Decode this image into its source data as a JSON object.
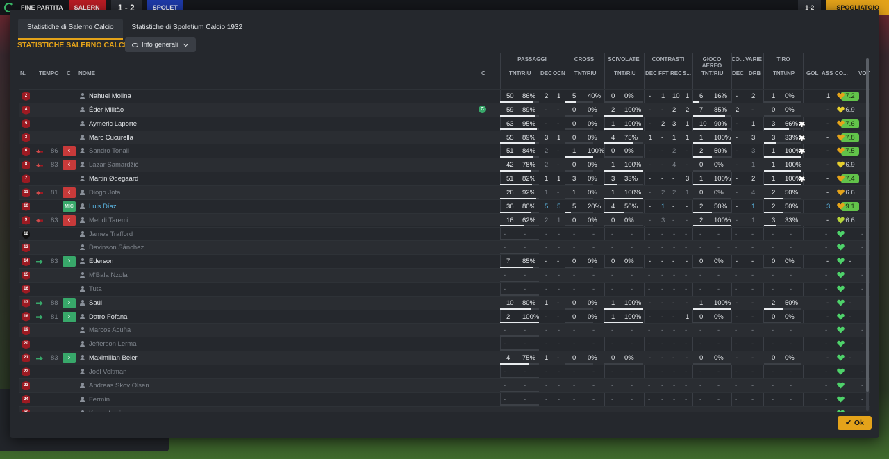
{
  "top_bar": {
    "status": "FINE PARTITA",
    "team1": "SALERN",
    "score": "1 - 2",
    "team2": "SPOLET",
    "score_right": "1-2",
    "continue": "SPOGLIATOIO"
  },
  "tabs": [
    "Statistiche di Salerno Calcio",
    "Statistiche di Spoletium Calcio 1932"
  ],
  "section_title": "STATISTICHE SALERNO CALCIO",
  "view_select": "Info generali",
  "groups": {
    "passaggi": "PASSAGGI",
    "cross": "CROSS",
    "scivolate": "SCIVOLATE",
    "contrasti": "CONTRASTI",
    "gioco_aereo": "GIOCO AEREO",
    "co": "CO...",
    "varie": "VARIE",
    "tiro": "TIRO"
  },
  "headers": {
    "n": "N.",
    "tempo": "TEMPO",
    "c": "C",
    "nome": "NOME",
    "c2": "C",
    "tnt_riu": "TNT/RIU",
    "dec": "DEC",
    "ocn": "OCN",
    "cross_tnt": "TNT/RIU",
    "sciv_tnt": "TNT/RIU",
    "con_dec": "DEC",
    "fft": "FFT",
    "rec": "REC",
    "s": "S...",
    "aereo_tnt": "TNT/RIU",
    "co_dec": "DEC",
    "drb": "DRB",
    "tiro_tnt": "TNT\\INP",
    "gol": "GOL",
    "ass": "ASS",
    "co2": "CO...",
    "vot": "VOT"
  },
  "players": [
    {
      "num": "2",
      "sub": "",
      "min": "",
      "name": "Nahuel Molina",
      "pas": [
        "50",
        "86%"
      ],
      "dec": "2",
      "ocn": "1",
      "cr": [
        "5",
        "40%"
      ],
      "sc": [
        "0",
        "0%"
      ],
      "cd": "-",
      "fft": "1",
      "rec": "10",
      "s": "1",
      "ae": [
        "6",
        "16%"
      ],
      "cdec": "-",
      "drb": "2",
      "ti": [
        "1",
        "0%"
      ],
      "gol": "",
      "ass": "1",
      "mood": "orange",
      "vot": "7.2",
      "vg": true
    },
    {
      "num": "4",
      "sub": "",
      "min": "",
      "name": "Éder Militão",
      "gc": "C",
      "pas": [
        "59",
        "89%"
      ],
      "dec": "-",
      "ocn": "-",
      "cr": [
        "0",
        "0%"
      ],
      "sc": [
        "2",
        "100%"
      ],
      "cd": "-",
      "fft": "-",
      "rec": "2",
      "s": "2",
      "ae": [
        "7",
        "85%"
      ],
      "cdec": "2",
      "drb": "-",
      "ti": [
        "0",
        "0%"
      ],
      "gol": "",
      "ass": "-",
      "mood": "yellow",
      "vot": "6.9",
      "vg": false
    },
    {
      "num": "5",
      "sub": "",
      "min": "",
      "name": "Aymeric Laporte",
      "pas": [
        "63",
        "95%"
      ],
      "dec": "-",
      "ocn": "-",
      "cr": [
        "0",
        "0%"
      ],
      "sc": [
        "1",
        "100%"
      ],
      "cd": "-",
      "fft": "2",
      "rec": "3",
      "s": "1",
      "ae": [
        "10",
        "90%"
      ],
      "cdec": "-",
      "drb": "1",
      "ti": [
        "3",
        "66%"
      ],
      "gol": "ball",
      "ass": "-",
      "mood": "orange",
      "vot": "7.6",
      "vg": true
    },
    {
      "num": "3",
      "sub": "",
      "min": "",
      "name": "Marc Cucurella",
      "pas": [
        "55",
        "89%"
      ],
      "dec": "3",
      "ocn": "1",
      "cr": [
        "0",
        "0%"
      ],
      "sc": [
        "4",
        "75%"
      ],
      "cd": "1",
      "fft": "-",
      "rec": "1",
      "s": "1",
      "ae": [
        "1",
        "100%"
      ],
      "cdec": "-",
      "drb": "3",
      "ti": [
        "3",
        "33%"
      ],
      "gol": "ball",
      "ass": "-",
      "mood": "orange",
      "vot": "7.8",
      "vg": true
    },
    {
      "num": "6",
      "sub": "out",
      "min": "86",
      "name": "Sandro Tonali",
      "dim": true,
      "pas": [
        "51",
        "84%"
      ],
      "dec": "2",
      "ocn": "-",
      "cr": [
        "1",
        "100%"
      ],
      "sc": [
        "0",
        "0%"
      ],
      "cd": "-",
      "fft": "-",
      "rec": "2",
      "s": "-",
      "ae": [
        "2",
        "50%"
      ],
      "cdec": "-",
      "drb": "3",
      "ti": [
        "1",
        "100%"
      ],
      "gol": "ball",
      "ass": "-",
      "mood": "orange",
      "vot": "7.5",
      "vg": true
    },
    {
      "num": "8",
      "sub": "out",
      "min": "83",
      "name": "Lazar Samardžić",
      "dim": true,
      "pas": [
        "42",
        "78%"
      ],
      "dec": "2",
      "ocn": "-",
      "cr": [
        "0",
        "0%"
      ],
      "sc": [
        "1",
        "100%"
      ],
      "cd": "-",
      "fft": "-",
      "rec": "4",
      "s": "-",
      "ae": [
        "0",
        "0%"
      ],
      "cdec": "-",
      "drb": "1",
      "ti": [
        "1",
        "100%"
      ],
      "gol": "",
      "ass": "-",
      "mood": "yellow",
      "vot": "6.9",
      "vg": false
    },
    {
      "num": "7",
      "sub": "",
      "min": "",
      "name": "Martin Ødegaard",
      "pas": [
        "51",
        "82%"
      ],
      "dec": "1",
      "ocn": "1",
      "cr": [
        "3",
        "0%"
      ],
      "sc": [
        "3",
        "33%"
      ],
      "cd": "-",
      "fft": "-",
      "rec": "-",
      "s": "3",
      "ae": [
        "1",
        "100%"
      ],
      "cdec": "-",
      "drb": "2",
      "ti": [
        "1",
        "100%"
      ],
      "gol": "ball",
      "ass": "-",
      "mood": "orange",
      "vot": "7.4",
      "vg": true
    },
    {
      "num": "11",
      "sub": "out",
      "min": "81",
      "name": "Diogo Jota",
      "dim": true,
      "pas": [
        "26",
        "92%"
      ],
      "dec": "1",
      "ocn": "-",
      "cr": [
        "1",
        "0%"
      ],
      "sc": [
        "1",
        "100%"
      ],
      "cd": "-",
      "fft": "2",
      "rec": "2",
      "s": "1",
      "ae": [
        "0",
        "0%"
      ],
      "cdec": "-",
      "drb": "4",
      "ti": [
        "2",
        "50%"
      ],
      "gol": "",
      "ass": "-",
      "mood": "orange",
      "vot": "6.6",
      "vg": false
    },
    {
      "num": "10",
      "sub": "mic",
      "min": "",
      "name": "Luis Díaz",
      "cyan": true,
      "pas": [
        "36",
        "80%"
      ],
      "dec": "5",
      "ocn": "5",
      "cr": [
        "5",
        "20%"
      ],
      "sc": [
        "4",
        "50%"
      ],
      "cd": "-",
      "fft": "1",
      "rec": "-",
      "s": "-",
      "ae": [
        "2",
        "50%"
      ],
      "cdec": "-",
      "drb": "1",
      "ti": [
        "2",
        "50%"
      ],
      "gol": "",
      "ass": "3",
      "mood": "orange",
      "vot": "9.1",
      "vg": true
    },
    {
      "num": "9",
      "sub": "out",
      "min": "83",
      "name": "Mehdi Taremi",
      "dim": true,
      "pas": [
        "16",
        "62%"
      ],
      "dec": "2",
      "ocn": "1",
      "cr": [
        "0",
        "0%"
      ],
      "sc": [
        "0",
        "0%"
      ],
      "cd": "-",
      "fft": "3",
      "rec": "-",
      "s": "-",
      "ae": [
        "2",
        "100%"
      ],
      "cdec": "-",
      "drb": "1",
      "ti": [
        "3",
        "33%"
      ],
      "gol": "",
      "ass": "-",
      "mood": "lime",
      "vot": "6.6",
      "vg": false
    },
    {
      "num": "12",
      "gk": true,
      "sub": "",
      "min": "",
      "name": "James Trafford",
      "dim": true,
      "empty": true,
      "mood": "green"
    },
    {
      "num": "13",
      "sub": "",
      "min": "",
      "name": "Davinson Sánchez",
      "dim": true,
      "empty": true,
      "mood": "green"
    },
    {
      "num": "14",
      "sub": "in",
      "min": "83",
      "name": "Ederson",
      "pas": [
        "7",
        "85%"
      ],
      "dec": "-",
      "ocn": "-",
      "cr": [
        "0",
        "0%"
      ],
      "sc": [
        "0",
        "0%"
      ],
      "cd": "-",
      "fft": "-",
      "rec": "-",
      "s": "-",
      "ae": [
        "0",
        "0%"
      ],
      "cdec": "-",
      "drb": "-",
      "ti": [
        "0",
        "0%"
      ],
      "gol": "",
      "ass": "-",
      "mood": "green",
      "vot": "-",
      "vg": false
    },
    {
      "num": "15",
      "sub": "",
      "min": "",
      "name": "M'Bala Nzola",
      "dim": true,
      "empty": true,
      "mood": "green"
    },
    {
      "num": "16",
      "sub": "",
      "min": "",
      "name": "Tuta",
      "dim": true,
      "empty": true,
      "mood": "green"
    },
    {
      "num": "17",
      "sub": "in",
      "min": "88",
      "name": "Saúl",
      "pas": [
        "10",
        "80%"
      ],
      "dec": "1",
      "ocn": "-",
      "cr": [
        "0",
        "0%"
      ],
      "sc": [
        "1",
        "100%"
      ],
      "cd": "-",
      "fft": "-",
      "rec": "-",
      "s": "-",
      "ae": [
        "1",
        "100%"
      ],
      "cdec": "-",
      "drb": "-",
      "ti": [
        "2",
        "50%"
      ],
      "gol": "",
      "ass": "-",
      "mood": "green",
      "vot": "-",
      "vg": false
    },
    {
      "num": "18",
      "sub": "in",
      "min": "81",
      "name": "Datro Fofana",
      "pas": [
        "2",
        "100%"
      ],
      "dec": "-",
      "ocn": "-",
      "cr": [
        "0",
        "0%"
      ],
      "sc": [
        "1",
        "100%"
      ],
      "cd": "-",
      "fft": "-",
      "rec": "-",
      "s": "1",
      "ae": [
        "0",
        "0%"
      ],
      "cdec": "-",
      "drb": "-",
      "ti": [
        "0",
        "0%"
      ],
      "gol": "",
      "ass": "-",
      "mood": "green",
      "vot": "-",
      "vg": false
    },
    {
      "num": "19",
      "sub": "",
      "min": "",
      "name": "Marcos Acuña",
      "dim": true,
      "empty": true,
      "mood": "green"
    },
    {
      "num": "20",
      "sub": "",
      "min": "",
      "name": "Jefferson Lerma",
      "dim": true,
      "empty": true,
      "mood": "green"
    },
    {
      "num": "21",
      "sub": "in",
      "min": "83",
      "name": "Maximilian Beier",
      "pas": [
        "4",
        "75%"
      ],
      "dec": "1",
      "ocn": "-",
      "cr": [
        "0",
        "0%"
      ],
      "sc": [
        "0",
        "0%"
      ],
      "cd": "-",
      "fft": "-",
      "rec": "-",
      "s": "-",
      "ae": [
        "0",
        "0%"
      ],
      "cdec": "-",
      "drb": "-",
      "ti": [
        "0",
        "0%"
      ],
      "gol": "",
      "ass": "-",
      "mood": "green",
      "vot": "-",
      "vg": false
    },
    {
      "num": "22",
      "sub": "",
      "min": "",
      "name": "Joël Veltman",
      "dim": true,
      "empty": true,
      "mood": "green"
    },
    {
      "num": "23",
      "sub": "",
      "min": "",
      "name": "Andreas Skov Olsen",
      "dim": true,
      "empty": true,
      "mood": "green"
    },
    {
      "num": "24",
      "sub": "",
      "min": "",
      "name": "Fermín",
      "dim": true,
      "empty": true,
      "mood": "green"
    },
    {
      "num": "25",
      "sub": "",
      "min": "",
      "name": "Konrad Laimer",
      "dim": true,
      "empty": true,
      "mood": "green"
    }
  ],
  "ok_button": "Ok",
  "colors": {
    "accent": "#e4a31a",
    "vote_good": "#62c34a",
    "sub_in": "#38a86a",
    "sub_out": "#c83a3a"
  }
}
